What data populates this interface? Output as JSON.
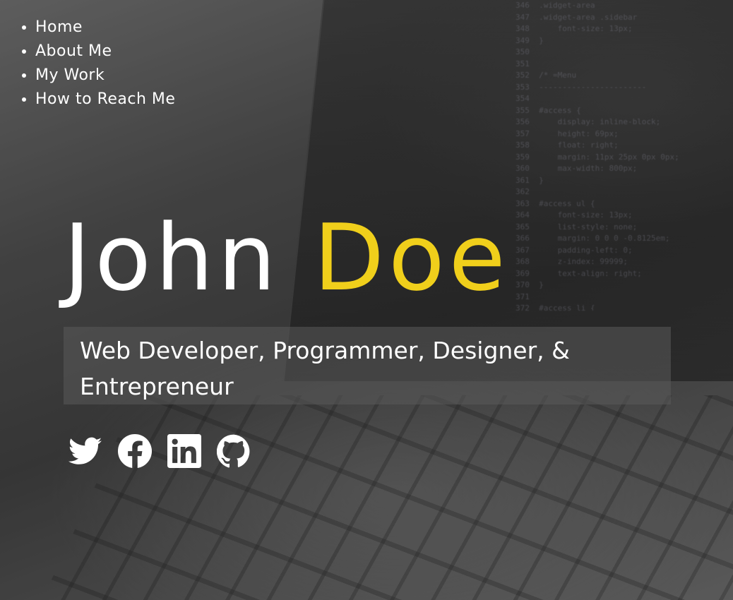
{
  "nav": {
    "items": [
      {
        "label": "Home"
      },
      {
        "label": "About Me"
      },
      {
        "label": "My Work"
      },
      {
        "label": "How to Reach Me"
      }
    ]
  },
  "hero": {
    "first_name": "John",
    "last_name": "Doe",
    "tagline": "Web Developer, Programmer, Designer, & Entrepreneur"
  },
  "social": {
    "icons": [
      "twitter-icon",
      "facebook-icon",
      "linkedin-icon",
      "github-icon"
    ]
  },
  "colors": {
    "accent": "#f0cf1b",
    "text": "#ffffff",
    "tagline_bg": "#5a5a5a"
  }
}
